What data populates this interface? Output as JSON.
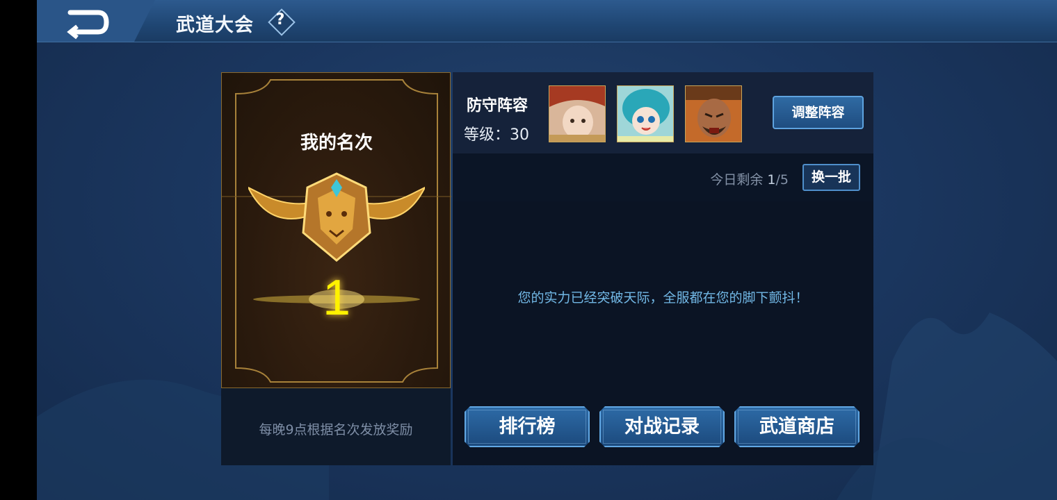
{
  "header": {
    "title": "武道大会",
    "help_symbol": "?"
  },
  "rank": {
    "label": "我的名次",
    "value": "1",
    "reward_note": "每晚9点根据名次发放奖励"
  },
  "defense_lineup": {
    "title": "防守阵容",
    "level_text": "等级：30",
    "heroes": [
      "hero-portrait-girl-red-hat",
      "hero-portrait-girl-teal-hair",
      "hero-portrait-bearded-warrior"
    ],
    "adjust_button": "调整阵容"
  },
  "opponents": {
    "remaining_label": "今日剩余",
    "remaining_current": "1",
    "remaining_total": "/5",
    "refresh_button": "换一批",
    "message": "您的实力已经突破天际，全服都在您的脚下颤抖！"
  },
  "actions": {
    "leaderboard": "排行榜",
    "battle_record": "对战记录",
    "shop": "武道商店"
  },
  "colors": {
    "accent_gold": "#fff200",
    "button_blue": "#2d6aa6",
    "message_blue": "#72b8e6"
  }
}
